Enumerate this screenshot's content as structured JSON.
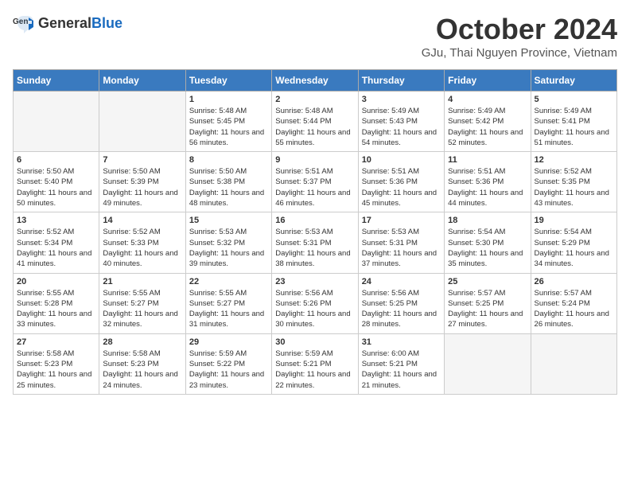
{
  "header": {
    "logo_general": "General",
    "logo_blue": "Blue",
    "month_title": "October 2024",
    "location": "GJu, Thai Nguyen Province, Vietnam"
  },
  "days_of_week": [
    "Sunday",
    "Monday",
    "Tuesday",
    "Wednesday",
    "Thursday",
    "Friday",
    "Saturday"
  ],
  "weeks": [
    [
      {
        "day": "",
        "empty": true
      },
      {
        "day": "",
        "empty": true
      },
      {
        "day": "1",
        "sunrise": "5:48 AM",
        "sunset": "5:45 PM",
        "daylight": "11 hours and 56 minutes."
      },
      {
        "day": "2",
        "sunrise": "5:48 AM",
        "sunset": "5:44 PM",
        "daylight": "11 hours and 55 minutes."
      },
      {
        "day": "3",
        "sunrise": "5:49 AM",
        "sunset": "5:43 PM",
        "daylight": "11 hours and 54 minutes."
      },
      {
        "day": "4",
        "sunrise": "5:49 AM",
        "sunset": "5:42 PM",
        "daylight": "11 hours and 52 minutes."
      },
      {
        "day": "5",
        "sunrise": "5:49 AM",
        "sunset": "5:41 PM",
        "daylight": "11 hours and 51 minutes."
      }
    ],
    [
      {
        "day": "6",
        "sunrise": "5:50 AM",
        "sunset": "5:40 PM",
        "daylight": "11 hours and 50 minutes."
      },
      {
        "day": "7",
        "sunrise": "5:50 AM",
        "sunset": "5:39 PM",
        "daylight": "11 hours and 49 minutes."
      },
      {
        "day": "8",
        "sunrise": "5:50 AM",
        "sunset": "5:38 PM",
        "daylight": "11 hours and 48 minutes."
      },
      {
        "day": "9",
        "sunrise": "5:51 AM",
        "sunset": "5:37 PM",
        "daylight": "11 hours and 46 minutes."
      },
      {
        "day": "10",
        "sunrise": "5:51 AM",
        "sunset": "5:36 PM",
        "daylight": "11 hours and 45 minutes."
      },
      {
        "day": "11",
        "sunrise": "5:51 AM",
        "sunset": "5:36 PM",
        "daylight": "11 hours and 44 minutes."
      },
      {
        "day": "12",
        "sunrise": "5:52 AM",
        "sunset": "5:35 PM",
        "daylight": "11 hours and 43 minutes."
      }
    ],
    [
      {
        "day": "13",
        "sunrise": "5:52 AM",
        "sunset": "5:34 PM",
        "daylight": "11 hours and 41 minutes."
      },
      {
        "day": "14",
        "sunrise": "5:52 AM",
        "sunset": "5:33 PM",
        "daylight": "11 hours and 40 minutes."
      },
      {
        "day": "15",
        "sunrise": "5:53 AM",
        "sunset": "5:32 PM",
        "daylight": "11 hours and 39 minutes."
      },
      {
        "day": "16",
        "sunrise": "5:53 AM",
        "sunset": "5:31 PM",
        "daylight": "11 hours and 38 minutes."
      },
      {
        "day": "17",
        "sunrise": "5:53 AM",
        "sunset": "5:31 PM",
        "daylight": "11 hours and 37 minutes."
      },
      {
        "day": "18",
        "sunrise": "5:54 AM",
        "sunset": "5:30 PM",
        "daylight": "11 hours and 35 minutes."
      },
      {
        "day": "19",
        "sunrise": "5:54 AM",
        "sunset": "5:29 PM",
        "daylight": "11 hours and 34 minutes."
      }
    ],
    [
      {
        "day": "20",
        "sunrise": "5:55 AM",
        "sunset": "5:28 PM",
        "daylight": "11 hours and 33 minutes."
      },
      {
        "day": "21",
        "sunrise": "5:55 AM",
        "sunset": "5:27 PM",
        "daylight": "11 hours and 32 minutes."
      },
      {
        "day": "22",
        "sunrise": "5:55 AM",
        "sunset": "5:27 PM",
        "daylight": "11 hours and 31 minutes."
      },
      {
        "day": "23",
        "sunrise": "5:56 AM",
        "sunset": "5:26 PM",
        "daylight": "11 hours and 30 minutes."
      },
      {
        "day": "24",
        "sunrise": "5:56 AM",
        "sunset": "5:25 PM",
        "daylight": "11 hours and 28 minutes."
      },
      {
        "day": "25",
        "sunrise": "5:57 AM",
        "sunset": "5:25 PM",
        "daylight": "11 hours and 27 minutes."
      },
      {
        "day": "26",
        "sunrise": "5:57 AM",
        "sunset": "5:24 PM",
        "daylight": "11 hours and 26 minutes."
      }
    ],
    [
      {
        "day": "27",
        "sunrise": "5:58 AM",
        "sunset": "5:23 PM",
        "daylight": "11 hours and 25 minutes."
      },
      {
        "day": "28",
        "sunrise": "5:58 AM",
        "sunset": "5:23 PM",
        "daylight": "11 hours and 24 minutes."
      },
      {
        "day": "29",
        "sunrise": "5:59 AM",
        "sunset": "5:22 PM",
        "daylight": "11 hours and 23 minutes."
      },
      {
        "day": "30",
        "sunrise": "5:59 AM",
        "sunset": "5:21 PM",
        "daylight": "11 hours and 22 minutes."
      },
      {
        "day": "31",
        "sunrise": "6:00 AM",
        "sunset": "5:21 PM",
        "daylight": "11 hours and 21 minutes."
      },
      {
        "day": "",
        "empty": true
      },
      {
        "day": "",
        "empty": true
      }
    ]
  ]
}
